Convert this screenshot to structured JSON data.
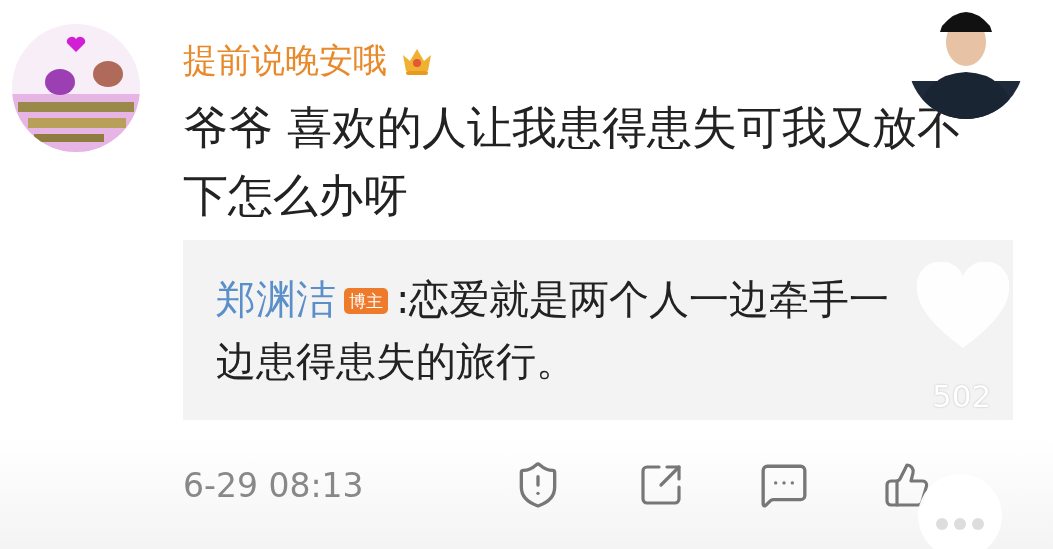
{
  "comment": {
    "username": "提前说晚安哦",
    "text": "爷爷 喜欢的人让我患得患失可我又放不下怎么办呀",
    "reply": {
      "author": "郑渊洁",
      "badge": "博主",
      "separator": ":",
      "lines": [
        "恋爱就是两个人一边牵手一",
        "边患得患失的旅行。"
      ]
    },
    "time": "6-29 08:13"
  },
  "overlay": {
    "likes": "502"
  }
}
